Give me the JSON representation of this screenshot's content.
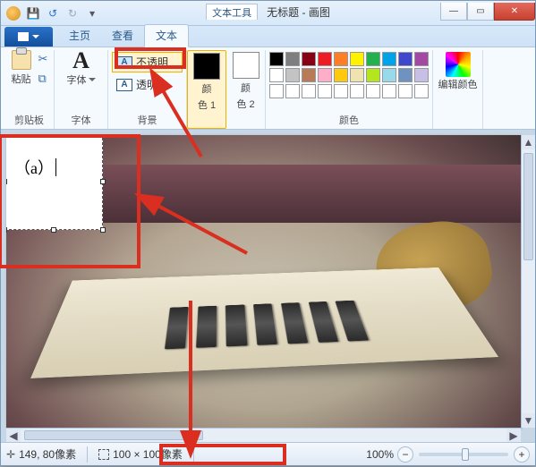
{
  "titlebar": {
    "tool_tab": "文本工具",
    "doc_title": "无标题 - 画图",
    "min_icon": "—",
    "max_icon": "▭",
    "close_icon": "✕"
  },
  "qat": {
    "save_icon": "💾",
    "undo_icon": "↺",
    "redo_icon": "↻"
  },
  "tabs": {
    "file": "",
    "home": "主页",
    "view": "查看",
    "text": "文本"
  },
  "ribbon": {
    "clipboard": {
      "paste_label": "粘贴",
      "cut_icon": "✂",
      "copy_icon": "⧉",
      "group_label": "剪贴板"
    },
    "font": {
      "glyph": "A",
      "label": "字体",
      "group_label": "字体"
    },
    "background": {
      "opaque": "不透明",
      "transparent": "透明",
      "group_label": "背景"
    },
    "color1": {
      "label_l1": "颜",
      "label_l2": "色 1"
    },
    "color2": {
      "label_l1": "颜",
      "label_l2": "色 2"
    },
    "palette": {
      "row1": [
        "#000000",
        "#7f7f7f",
        "#880015",
        "#ed1c24",
        "#ff7f27",
        "#fff200",
        "#22b14c",
        "#00a2e8",
        "#3f48cc",
        "#a349a4"
      ],
      "row2": [
        "#ffffff",
        "#c3c3c3",
        "#b97a57",
        "#ffaec9",
        "#ffc90e",
        "#efe4b0",
        "#b5e61d",
        "#99d9ea",
        "#7092be",
        "#c8bfe7"
      ],
      "row3": [
        "#ffffff",
        "#ffffff",
        "#ffffff",
        "#ffffff",
        "#ffffff",
        "#ffffff",
        "#ffffff",
        "#ffffff",
        "#ffffff",
        "#ffffff"
      ],
      "group_label": "颜色"
    },
    "edit_colors": {
      "label": "编辑颜色"
    }
  },
  "canvas": {
    "textbox_content": "（a）"
  },
  "status": {
    "cursor_pos": "149, 80像素",
    "selection_dim": "100 × 100像素",
    "zoom": "100%",
    "minus": "−",
    "plus": "+"
  }
}
